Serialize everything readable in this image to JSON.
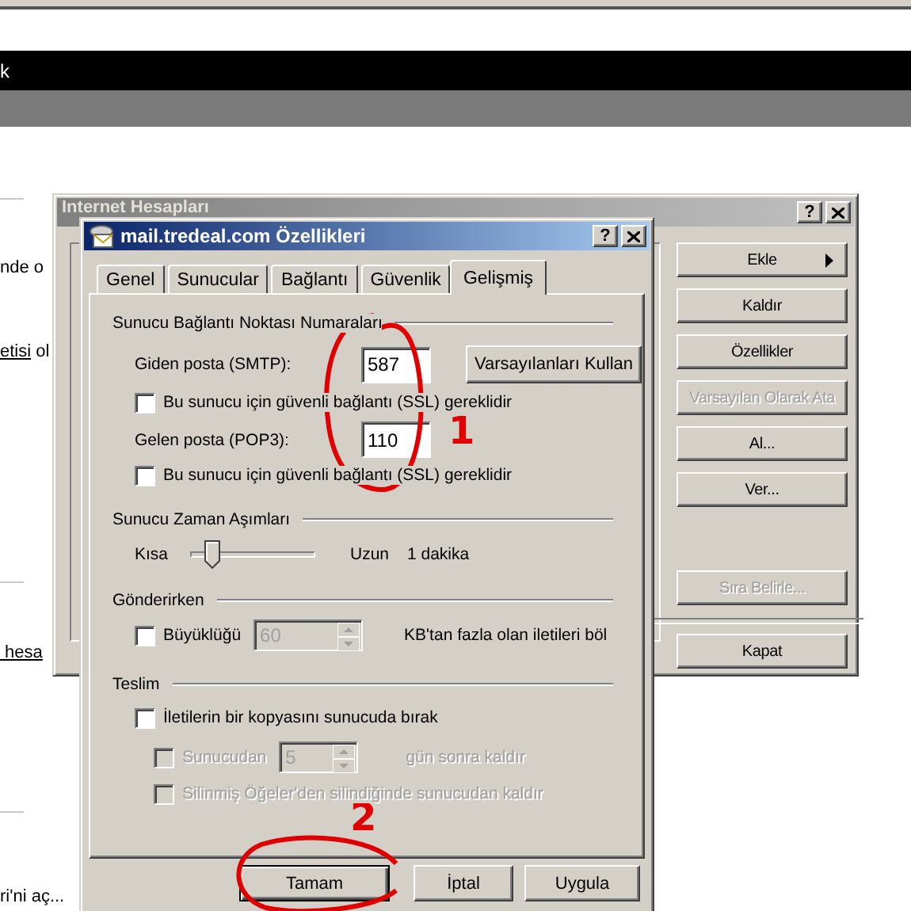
{
  "browser": {
    "toolbar_text": "k",
    "lines": [
      {
        "text": "nde o"
      },
      {
        "link": "etisi",
        "text": " ol"
      },
      {
        "link": " hesa"
      },
      {
        "text": "ri'ni aç..."
      }
    ]
  },
  "accounts_window": {
    "title": "Internet Hesapları",
    "help_button": "?",
    "buttons": [
      {
        "label": "Ekle",
        "disabled": false,
        "submenu": true
      },
      {
        "label": "Kaldır",
        "disabled": false,
        "submenu": false
      },
      {
        "label": "Özellikler",
        "disabled": false,
        "submenu": false
      },
      {
        "label": "Varsayılan Olarak Ata",
        "disabled": true,
        "submenu": false
      },
      {
        "label": "Al...",
        "disabled": false,
        "submenu": false
      },
      {
        "label": "Ver...",
        "disabled": false,
        "submenu": false
      }
    ],
    "order_button": {
      "label": "Sıra Belirle...",
      "disabled": true
    },
    "close_button": {
      "label": "Kapat",
      "disabled": false
    }
  },
  "dialog": {
    "title": "mail.tredeal.com Özellikleri",
    "help_button": "?",
    "tabs": [
      {
        "label": "Genel",
        "selected": false
      },
      {
        "label": "Sunucular",
        "selected": false
      },
      {
        "label": "Bağlantı",
        "selected": false
      },
      {
        "label": "Güvenlik",
        "selected": false
      },
      {
        "label": "Gelişmiş",
        "selected": true
      }
    ],
    "ports": {
      "heading": "Sunucu Bağlantı Noktası Numaraları",
      "smtp": {
        "label": "Giden posta (SMTP):",
        "value": "587"
      },
      "defaults_button": "Varsayılanları Kullan",
      "smtp_ssl": {
        "label": "Bu sunucu için güvenli bağlantı (SSL) gereklidir",
        "checked": false
      },
      "pop3": {
        "label": "Gelen posta (POP3):",
        "value": "110"
      },
      "pop3_ssl": {
        "label": "Bu sunucu için güvenli bağlantı (SSL) gereklidir",
        "checked": false
      }
    },
    "timeouts": {
      "heading": "Sunucu Zaman Aşımları",
      "min_label": "Kısa",
      "max_label": "Uzun",
      "level": 0.13,
      "reading": "1 dakika"
    },
    "sending": {
      "heading": "Gönderirken",
      "split": {
        "label": "Büyüklüğü",
        "checked": false
      },
      "size": {
        "value": "60",
        "disabled": true
      },
      "suffix": "KB'tan fazla olan iletileri böl"
    },
    "delivery": {
      "heading": "Teslim",
      "keep_copy": {
        "label": "İletilerin bir kopyasını sunucuda bırak",
        "checked": false
      },
      "remove_after": {
        "label": "Sunucudan",
        "checked": false,
        "disabled": true
      },
      "days": {
        "value": "5",
        "disabled": true
      },
      "days_suffix": "gün sonra kaldır",
      "remove_deleted": {
        "label": "Silinmiş Öğeler'den silindiğinde sunucudan kaldır",
        "checked": false,
        "disabled": true
      }
    },
    "buttons": [
      {
        "label": "Tamam",
        "default": true
      },
      {
        "label": "İptal",
        "default": false
      },
      {
        "label": "Uygula",
        "default": false
      }
    ]
  },
  "annotations": {
    "marks": [
      "1",
      "2"
    ]
  }
}
